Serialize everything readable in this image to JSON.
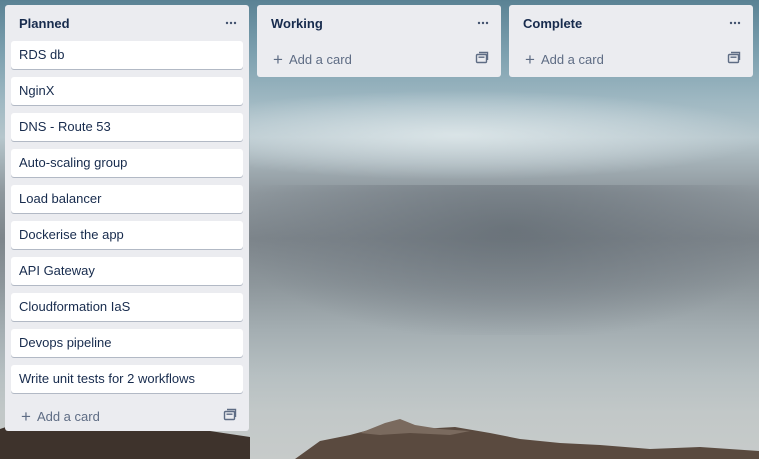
{
  "board": {
    "lists": [
      {
        "title": "Planned",
        "cards": [
          "RDS db",
          "NginX",
          "DNS - Route 53",
          "Auto-scaling group",
          "Load balancer",
          "Dockerise the app",
          "API Gateway",
          "Cloudformation IaS",
          "Devops pipeline",
          "Write unit tests for 2 workflows"
        ],
        "add_label": "Add a card"
      },
      {
        "title": "Working",
        "cards": [],
        "add_label": "Add a card"
      },
      {
        "title": "Complete",
        "cards": [],
        "add_label": "Add a card"
      }
    ]
  },
  "icons": {
    "list_menu": "ellipsis-icon",
    "add": "plus-icon",
    "template": "card-template-icon"
  },
  "colors": {
    "list_background": "#ebecf0",
    "card_background": "#ffffff",
    "text": "#172b4d",
    "muted_text": "#5e6c84"
  }
}
